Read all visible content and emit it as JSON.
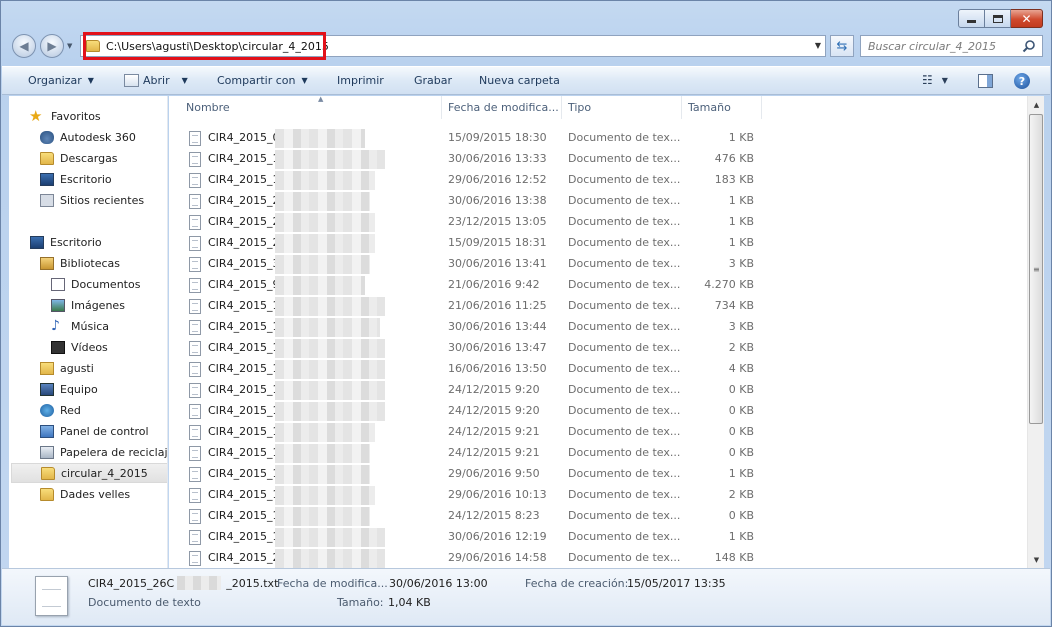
{
  "address": {
    "path": "C:\\Users\\agusti\\Desktop\\circular_4_2015"
  },
  "search": {
    "placeholder": "Buscar circular_4_2015"
  },
  "toolbar": {
    "organize": "Organizar",
    "open": "Abrir",
    "share": "Compartir con",
    "print": "Imprimir",
    "burn": "Grabar",
    "new_folder": "Nueva carpeta"
  },
  "nav": {
    "items": [
      {
        "label": "Favoritos",
        "icon": "star-icon"
      },
      {
        "label": "Autodesk 360",
        "icon": "cloud-icon"
      },
      {
        "label": "Descargas",
        "icon": "downloads-folder-icon"
      },
      {
        "label": "Escritorio",
        "icon": "desktop-icon"
      },
      {
        "label": "Sitios recientes",
        "icon": "recent-places-icon"
      },
      {
        "label": "Escritorio",
        "icon": "desktop-icon"
      },
      {
        "label": "Bibliotecas",
        "icon": "libraries-icon"
      },
      {
        "label": "Documentos",
        "icon": "documents-icon"
      },
      {
        "label": "Imágenes",
        "icon": "pictures-icon"
      },
      {
        "label": "Música",
        "icon": "music-icon"
      },
      {
        "label": "Vídeos",
        "icon": "videos-icon"
      },
      {
        "label": "agusti",
        "icon": "user-folder-icon"
      },
      {
        "label": "Equipo",
        "icon": "computer-icon"
      },
      {
        "label": "Red",
        "icon": "network-icon"
      },
      {
        "label": "Panel de control",
        "icon": "control-panel-icon"
      },
      {
        "label": "Papelera de reciclaje",
        "icon": "recycle-bin-icon"
      },
      {
        "label": "circular_4_2015",
        "icon": "folder-icon"
      },
      {
        "label": "Dades velles",
        "icon": "folder-icon"
      }
    ]
  },
  "columns": {
    "name": "Nombre",
    "date": "Fecha de modifica...",
    "type": "Tipo",
    "size": "Tamaño"
  },
  "files": [
    {
      "name": "CIR4_2015_0_",
      "date": "15/09/2015 18:30",
      "type": "Documento de tex...",
      "size": "1 KB"
    },
    {
      "name": "CIR4_2015_1_",
      "date": "30/06/2016 13:33",
      "type": "Documento de tex...",
      "size": "476 KB"
    },
    {
      "name": "CIR4_2015_1E",
      "date": "29/06/2016 12:52",
      "type": "Documento de tex...",
      "size": "183 KB"
    },
    {
      "name": "CIR4_2015_2_",
      "date": "30/06/2016 13:38",
      "type": "Documento de tex...",
      "size": "1 KB"
    },
    {
      "name": "CIR4_2015_2A",
      "date": "23/12/2015 13:05",
      "type": "Documento de tex...",
      "size": "1 KB"
    },
    {
      "name": "CIR4_2015_2E",
      "date": "15/09/2015 18:31",
      "type": "Documento de tex...",
      "size": "1 KB"
    },
    {
      "name": "CIR4_2015_3_",
      "date": "30/06/2016 13:41",
      "type": "Documento de tex...",
      "size": "3 KB"
    },
    {
      "name": "CIR4_2015_9_",
      "date": "21/06/2016 9:42",
      "type": "Documento de tex...",
      "size": "4.270 KB"
    },
    {
      "name": "CIR4_2015_10",
      "date": "21/06/2016 11:25",
      "type": "Documento de tex...",
      "size": "734 KB"
    },
    {
      "name": "CIR4_2015_11",
      "date": "30/06/2016 13:44",
      "type": "Documento de tex...",
      "size": "3 KB"
    },
    {
      "name": "CIR4_2015_12",
      "date": "30/06/2016 13:47",
      "type": "Documento de tex...",
      "size": "2 KB"
    },
    {
      "name": "CIR4_2015_12",
      "date": "16/06/2016 13:50",
      "type": "Documento de tex...",
      "size": "4 KB"
    },
    {
      "name": "CIR4_2015_13",
      "date": "24/12/2015 9:20",
      "type": "Documento de tex...",
      "size": "0 KB"
    },
    {
      "name": "CIR4_2015_13",
      "date": "24/12/2015 9:20",
      "type": "Documento de tex...",
      "size": "0 KB"
    },
    {
      "name": "CIR4_2015_13",
      "date": "24/12/2015 9:21",
      "type": "Documento de tex...",
      "size": "0 KB"
    },
    {
      "name": "CIR4_2015_14",
      "date": "24/12/2015 9:21",
      "type": "Documento de tex...",
      "size": "0 KB"
    },
    {
      "name": "CIR4_2015_15",
      "date": "29/06/2016 9:50",
      "type": "Documento de tex...",
      "size": "1 KB"
    },
    {
      "name": "CIR4_2015_16",
      "date": "29/06/2016 10:13",
      "type": "Documento de tex...",
      "size": "2 KB"
    },
    {
      "name": "CIR4_2015_17",
      "date": "24/12/2015 8:23",
      "type": "Documento de tex...",
      "size": "0 KB"
    },
    {
      "name": "CIR4_2015_19",
      "date": "30/06/2016 12:19",
      "type": "Documento de tex...",
      "size": "1 KB"
    },
    {
      "name": "CIR4_2015_20",
      "date": "29/06/2016 14:58",
      "type": "Documento de tex...",
      "size": "148 KB"
    }
  ],
  "details": {
    "filename_start": "CIR4_2015_26C",
    "filename_end": "_2015.txt",
    "file_type": "Documento de texto",
    "modified_label": "Fecha de modifica...",
    "modified_value": "30/06/2016 13:00",
    "created_label": "Fecha de creación:",
    "created_value": "15/05/2017 13:35",
    "size_label": "Tamaño:",
    "size_value": "1,04 KB"
  },
  "colors": {
    "highlight": "#e2111a",
    "selection": "#e1e1e1"
  }
}
